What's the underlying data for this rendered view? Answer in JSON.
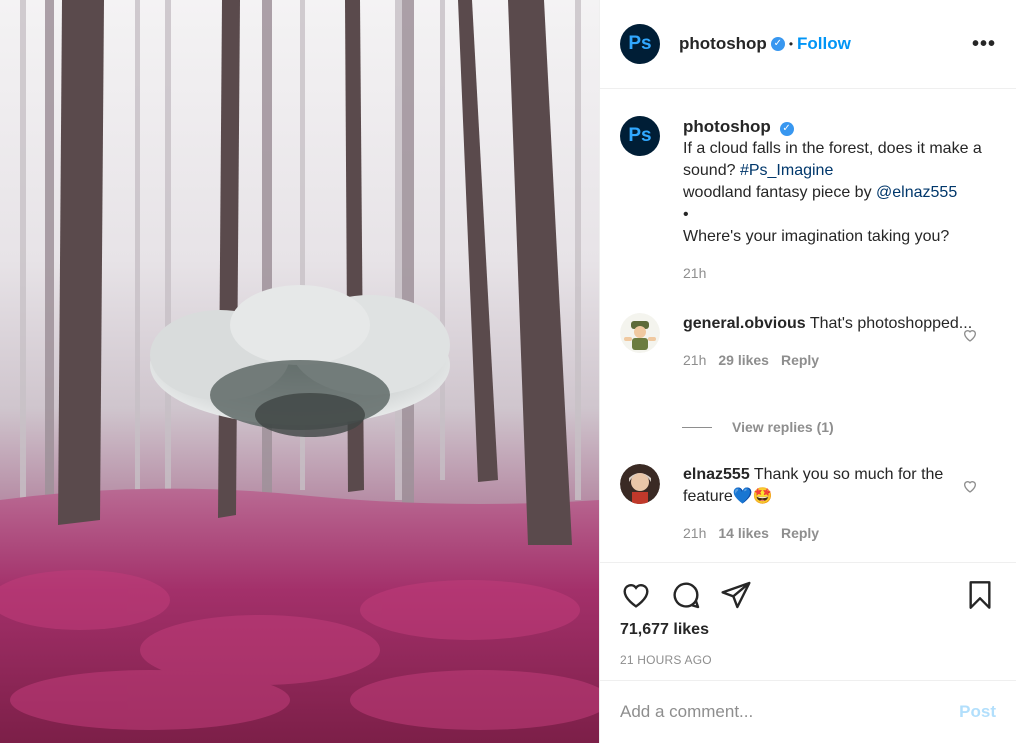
{
  "post": {
    "account": "photoshop",
    "avatar_text": "Ps",
    "separator": "•",
    "follow_label": "Follow",
    "more_label": "•••"
  },
  "caption": {
    "user": "photoshop",
    "text_line1": "If a cloud falls in the forest, does it make a sound?",
    "hashtag": "#Ps_Imagine",
    "text_line2": "woodland fantasy piece by",
    "mention": "@elnaz555",
    "bullet": "•",
    "text_line3": "Where's your imagination taking you?",
    "age": "21h"
  },
  "comments": [
    {
      "user": "general.obvious",
      "text": "That's photoshopped...",
      "age": "21h",
      "likes": "29 likes",
      "reply_label": "Reply",
      "view_replies": "View replies (1)"
    },
    {
      "user": "elnaz555",
      "text": "Thank you so much for the feature💙🤩",
      "age": "21h",
      "likes": "14 likes",
      "reply_label": "Reply"
    }
  ],
  "stats": {
    "likes": "71,677 likes",
    "posted": "21 HOURS AGO"
  },
  "composer": {
    "placeholder": "Add a comment...",
    "post_label": "Post"
  },
  "icons": {
    "like": "heart-icon",
    "comment": "comment-bubble-icon",
    "share": "paper-plane-icon",
    "save": "bookmark-icon",
    "verified": "verified-badge-icon",
    "comment_like": "heart-outline-icon"
  },
  "colors": {
    "follow_blue": "#0095f6",
    "verified_blue": "#3897f0",
    "muted_text": "#8e8e8e",
    "post_button_disabled": "#b2dffc",
    "hashtag_link": "#00376b"
  }
}
